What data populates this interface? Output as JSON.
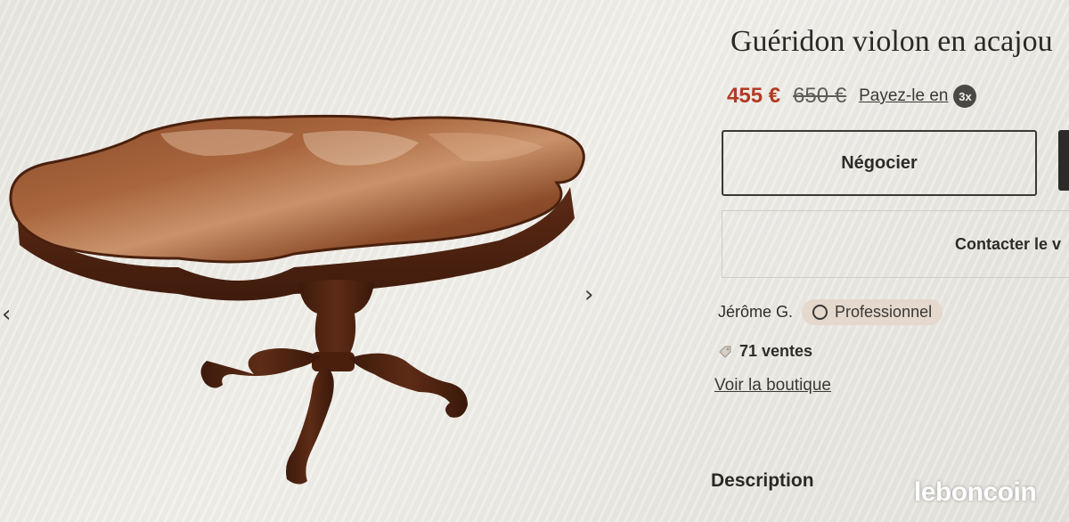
{
  "listing": {
    "title": "Guéridon violon en acajou",
    "price": "455 €",
    "old_price": "650 €",
    "pay_in_label": "Payez-le en",
    "pay_in_badge": "3x"
  },
  "actions": {
    "negotiate_label": "Négocier",
    "contact_label": "Contacter le v"
  },
  "seller": {
    "name": "Jérôme G.",
    "badge": "Professionnel",
    "sales": "71 ventes",
    "shop_link": "Voir la boutique"
  },
  "sections": {
    "description_title": "Description"
  },
  "carousel": {
    "prev_icon": "chevron-left-icon",
    "next_icon": "chevron-right-icon"
  },
  "watermark": "leboncoin",
  "colors": {
    "price": "#b33a24",
    "badge_bg": "#e5d8cc",
    "wood": "#6b3419"
  }
}
